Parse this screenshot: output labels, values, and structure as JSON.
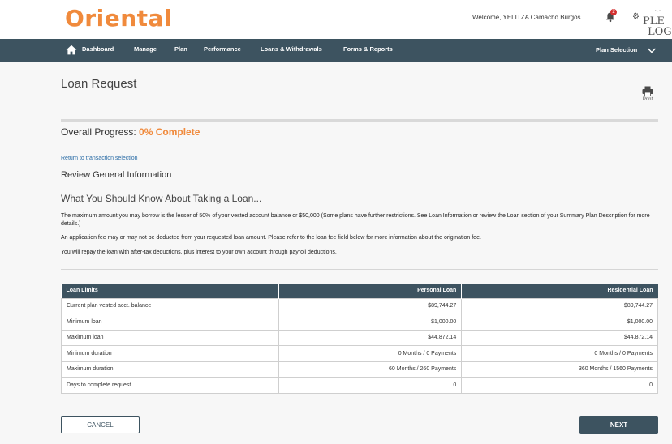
{
  "header": {
    "logo": "Oriental",
    "welcome": "Welcome, YELITZA Camacho Burgos",
    "notification_count": "2",
    "brand_partial_line1": "PLE",
    "brand_partial_line2": "LOG",
    "icons": {
      "bell": "bell-icon",
      "gear": "gear-icon"
    }
  },
  "nav": {
    "items": [
      {
        "label": "Dashboard"
      },
      {
        "label": "Manage"
      },
      {
        "label": "Plan"
      },
      {
        "label": "Performance"
      },
      {
        "label": "Loans & Withdrawals"
      },
      {
        "label": "Forms & Reports"
      }
    ],
    "plan_selection": "Plan Selection"
  },
  "page": {
    "title": "Loan Request",
    "print_label": "Print",
    "progress_label": "Overall Progress:",
    "progress_value": "0% Complete",
    "progress_fraction": 0,
    "return_link": "Return to transaction selection",
    "review_heading": "Review General Information",
    "know_heading": "What You Should Know About Taking a Loan...",
    "paragraphs": [
      "The maximum amount you may borrow is the lesser of 50% of your vested account balance or $50,000 (Some plans have further restrictions. See Loan Information or review the Loan section of your Summary Plan Description for more details.)",
      "An application fee may or may not be deducted from your requested loan amount. Please refer to the loan fee field below for more information about the origination fee.",
      "You will repay the loan with after-tax deductions, plus interest to your own account through payroll deductions."
    ]
  },
  "table": {
    "headers": [
      "Loan Limits",
      "Personal Loan",
      "Residential Loan"
    ],
    "rows": [
      [
        "Current plan vested acct. balance",
        "$89,744.27",
        "$89,744.27"
      ],
      [
        "Minimum loan",
        "$1,000.00",
        "$1,000.00"
      ],
      [
        "Maximum loan",
        "$44,872.14",
        "$44,872.14"
      ],
      [
        "Minimum duration",
        "0 Months / 0 Payments",
        "0 Months / 0 Payments"
      ],
      [
        "Maximum duration",
        "60 Months / 260 Payments",
        "360 Months / 1560 Payments"
      ],
      [
        "Days to complete request",
        "0",
        "0"
      ]
    ]
  },
  "buttons": {
    "cancel": "CANCEL",
    "next": "NEXT"
  },
  "colors": {
    "accent": "#f08a3c",
    "nav_bg": "#3d5360",
    "link": "#2a6ca6",
    "badge": "#d32f2f"
  }
}
